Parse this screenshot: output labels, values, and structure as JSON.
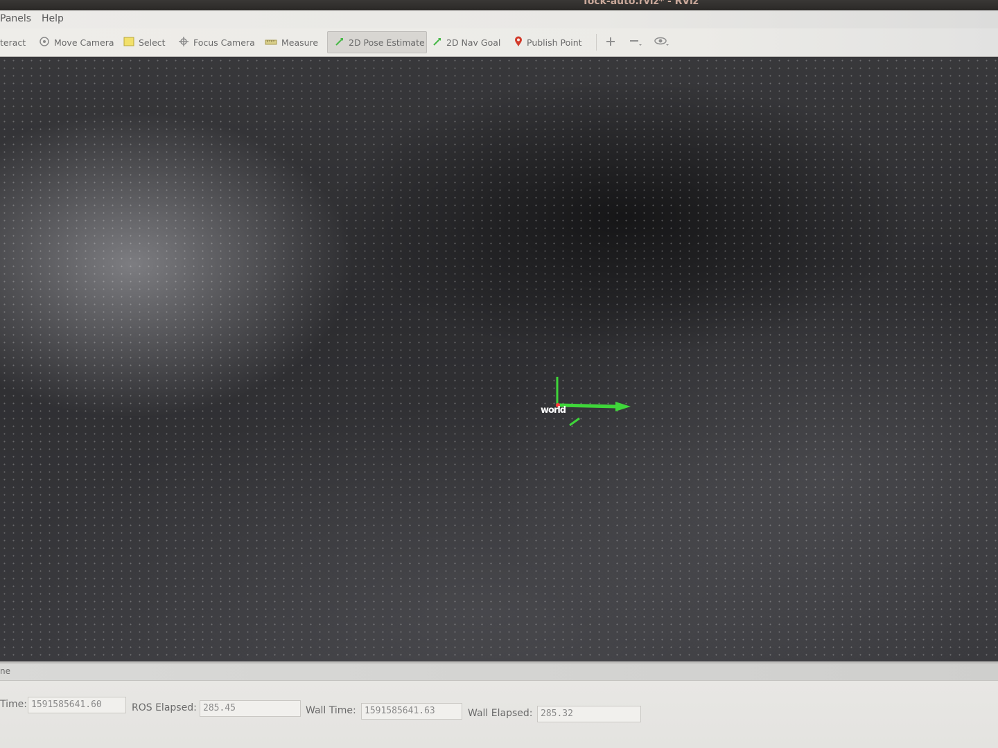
{
  "window": {
    "title": "Tock-auto.rviz* - RViz"
  },
  "menu": {
    "items": [
      "Panels",
      "Help"
    ]
  },
  "toolbar": {
    "interact_label": "teract",
    "move_camera_label": "Move Camera",
    "select_label": "Select",
    "focus_camera_label": "Focus Camera",
    "measure_label": "Measure",
    "pose_estimate_label": "2D Pose Estimate",
    "nav_goal_label": "2D Nav Goal",
    "publish_point_label": "Publish Point",
    "active_tool": "2D Pose Estimate"
  },
  "viewport": {
    "frame_label": "world",
    "background_color": "#2f2f32",
    "axis_colors": {
      "x": "#3fd63a",
      "y": "#3fd63a",
      "z": "#ff3030"
    }
  },
  "time_panel": {
    "title": "ne",
    "ros_time_label": "Time:",
    "ros_time_value": "1591585641.60",
    "ros_elapsed_label": "ROS Elapsed:",
    "ros_elapsed_value": "285.45",
    "wall_time_label": "Wall Time:",
    "wall_time_value": "1591585641.63",
    "wall_elapsed_label": "Wall Elapsed:",
    "wall_elapsed_value": "285.32"
  }
}
